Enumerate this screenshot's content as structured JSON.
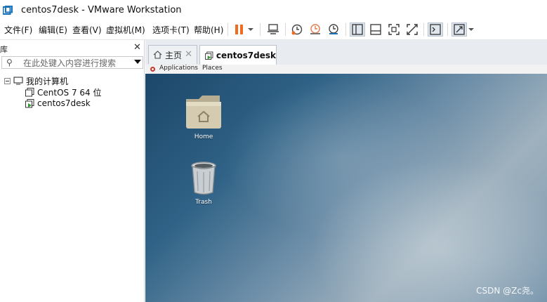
{
  "window": {
    "title": "centos7desk - VMware Workstation"
  },
  "menu": [
    {
      "id": "file",
      "label": "文件(F)"
    },
    {
      "id": "edit",
      "label": "编辑(E)"
    },
    {
      "id": "view",
      "label": "查看(V)"
    },
    {
      "id": "vm",
      "label": "虚拟机(M)"
    },
    {
      "id": "tabs",
      "label": "选项卡(T)"
    },
    {
      "id": "help",
      "label": "帮助(H)"
    }
  ],
  "toolbar": {
    "icons": [
      "pause-icon",
      "dropdown-icon",
      "send-ctrl-alt-del-icon",
      "snapshot-icon",
      "revert-snapshot-icon",
      "snapshot-manager-icon",
      "show-library-icon",
      "thumbnail-bar-icon",
      "full-screen-icon",
      "unity-icon",
      "console-view-icon",
      "stretch-view-icon"
    ]
  },
  "library": {
    "title": "库",
    "search_placeholder": "在此处键入内容进行搜索",
    "tree": {
      "root": "我的计算机",
      "items": [
        "CentOS 7 64 位",
        "centos7desk"
      ]
    }
  },
  "tabs": [
    {
      "label": "主页",
      "active": false
    },
    {
      "label": "centos7desk",
      "active": true
    }
  ],
  "guest": {
    "panel": {
      "applications": "Applications",
      "places": "Places"
    },
    "desktop_icons": [
      {
        "label": "Home",
        "icon": "home-folder-icon"
      },
      {
        "label": "Trash",
        "icon": "trash-icon"
      }
    ]
  },
  "watermark": "CSDN @Zc尧。",
  "colors": {
    "accent_pause": "#ef6b1f",
    "tab_active_border": "#b9c2cd",
    "desktop_top": "#1c476a"
  }
}
